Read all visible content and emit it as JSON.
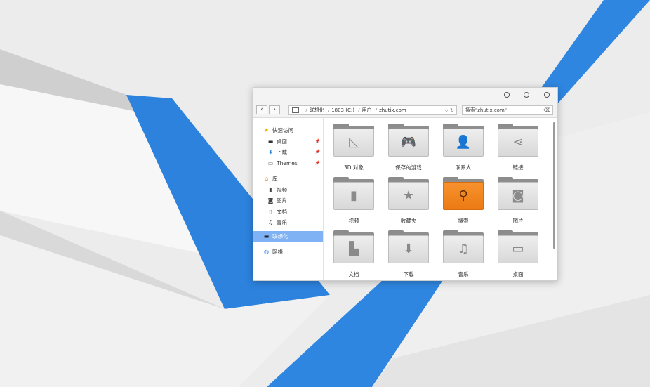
{
  "desktop": {
    "accent_color": "#2f86e0",
    "background_color": "#ececec"
  },
  "window": {
    "address": {
      "drive_icon": "drive-icon",
      "segments": [
        "联想化",
        "1803 (C:)",
        "用户",
        "zhutix.com"
      ],
      "dropdown": "⌵ ↻"
    },
    "search": {
      "text": "搜索\"zhutix.com\"",
      "clear": "⌫"
    },
    "nav": {
      "back": "‹",
      "forward": "›"
    },
    "sidebar": {
      "quick_access": "快速访问",
      "pinned": [
        "桌面",
        "下载",
        "Themes"
      ],
      "library": "库",
      "library_items": [
        "视频",
        "图片",
        "文档",
        "音乐"
      ],
      "this_pc": "联想化",
      "network": "网络"
    },
    "folders": [
      {
        "label": "3D 对象",
        "icon": "triangle-ruler-icon",
        "glyph": "◺"
      },
      {
        "label": "保存的游戏",
        "icon": "gamepad-icon",
        "glyph": "🎮"
      },
      {
        "label": "联系人",
        "icon": "person-icon",
        "glyph": "👤"
      },
      {
        "label": "链接",
        "icon": "share-icon",
        "glyph": "⋖"
      },
      {
        "label": "视频",
        "icon": "film-icon",
        "glyph": "▮"
      },
      {
        "label": "收藏夹",
        "icon": "star-icon",
        "glyph": "★"
      },
      {
        "label": "搜索",
        "icon": "magnifier-icon",
        "glyph": "⚲"
      },
      {
        "label": "图片",
        "icon": "camera-icon",
        "glyph": "◙"
      },
      {
        "label": "文档",
        "icon": "document-icon",
        "glyph": "▙"
      },
      {
        "label": "下载",
        "icon": "download-arrow-icon",
        "glyph": "⬇"
      },
      {
        "label": "音乐",
        "icon": "music-note-icon",
        "glyph": "♫"
      },
      {
        "label": "桌面",
        "icon": "desktop-icon",
        "glyph": "▭"
      }
    ]
  }
}
